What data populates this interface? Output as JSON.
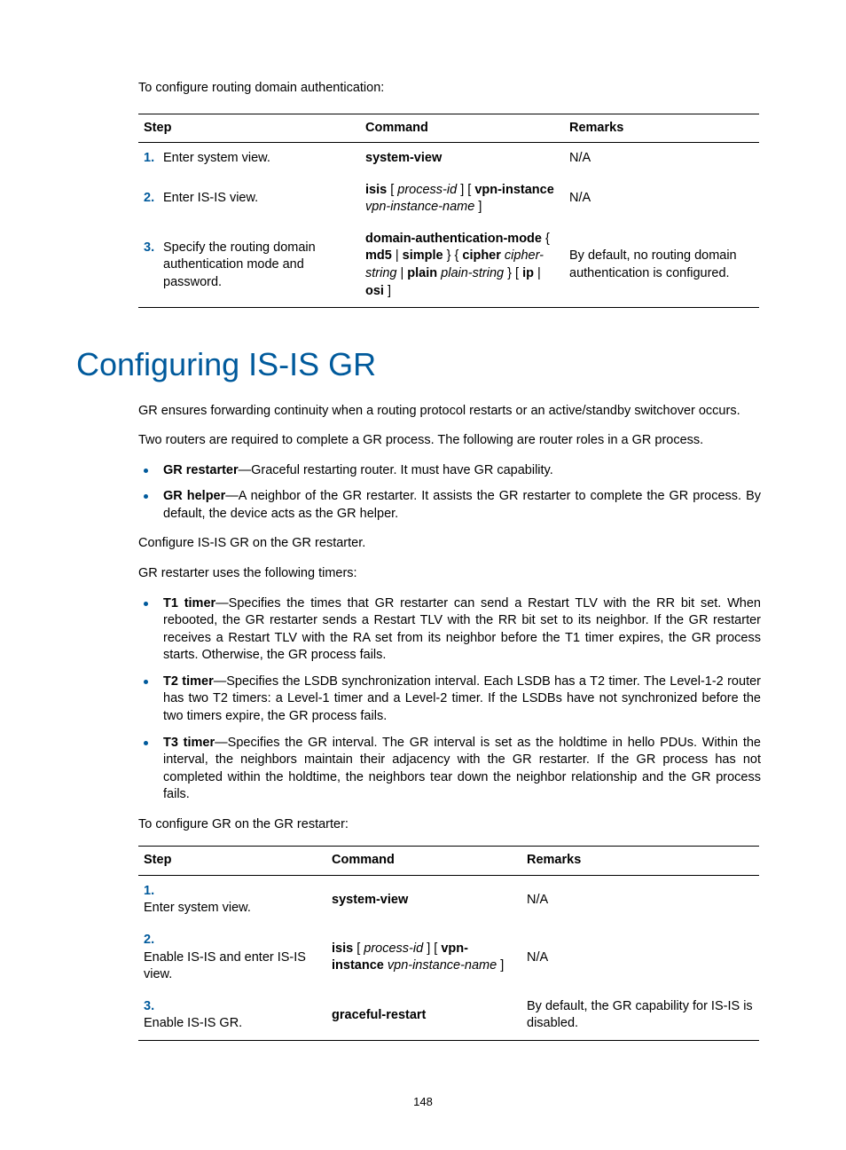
{
  "intro1": "To configure routing domain authentication:",
  "table1": {
    "headers": {
      "step": "Step",
      "command": "Command",
      "remarks": "Remarks"
    },
    "rows": [
      {
        "num": "1.",
        "desc": "Enter system view.",
        "cmd_html": "<b>system-view</b>",
        "remarks": "N/A"
      },
      {
        "num": "2.",
        "desc": "Enter IS-IS view.",
        "cmd_html": "<b>isis</b> [ <i>process-id</i> ] [ <b>vpn-instance</b> <i>vpn-instance-name</i> ]",
        "remarks": "N/A"
      },
      {
        "num": "3.",
        "desc": "Specify the routing domain authentication mode and password.",
        "cmd_html": "<b>domain-authentication-mode</b> { <b>md5</b> | <b>simple</b> } { <b>cipher</b> <i>cipher-string</i> | <b>plain</b> <i>plain-string</i> } [ <b>ip</b> | <b>osi</b> ]",
        "remarks": "By default, no routing domain authentication is configured."
      }
    ]
  },
  "h1": "Configuring IS-IS GR",
  "p1": "GR ensures forwarding continuity when a routing protocol restarts or an active/standby switchover occurs.",
  "p2": "Two routers are required to complete a GR process. The following are router roles in a GR process.",
  "bullets1": [
    {
      "bold": "GR restarter",
      "rest": "—Graceful restarting router. It must have GR capability."
    },
    {
      "bold": "GR helper",
      "rest": "—A neighbor of the GR restarter. It assists the GR restarter to complete the GR process. By default, the device acts as the GR helper."
    }
  ],
  "p3": "Configure IS-IS GR on the GR restarter.",
  "p4": "GR restarter uses the following timers:",
  "bullets2": [
    {
      "bold": "T1 timer",
      "rest": "—Specifies the times that GR restarter can send a Restart TLV with the RR bit set. When rebooted, the GR restarter sends a Restart TLV with the RR bit set to its neighbor. If the GR restarter receives a Restart TLV with the RA set from its neighbor before the T1 timer expires, the GR process starts. Otherwise, the GR process fails."
    },
    {
      "bold": "T2 timer",
      "rest": "—Specifies the LSDB synchronization interval. Each LSDB has a T2 timer. The Level-1-2 router has two T2 timers: a Level-1 timer and a Level-2 timer. If the LSDBs have not synchronized before the two timers expire, the GR process fails."
    },
    {
      "bold": "T3 timer",
      "rest": "—Specifies the GR interval. The GR interval is set as the holdtime in hello PDUs. Within the interval, the neighbors maintain their adjacency with the GR restarter. If the GR process has not completed within the holdtime, the neighbors tear down the neighbor relationship and the GR process fails."
    }
  ],
  "p5": "To configure GR on the GR restarter:",
  "table2": {
    "headers": {
      "step": "Step",
      "command": "Command",
      "remarks": "Remarks"
    },
    "rows": [
      {
        "num": "1.",
        "desc": "Enter system view.",
        "cmd_html": "<b>system-view</b>",
        "remarks": "N/A"
      },
      {
        "num": "2.",
        "desc": "Enable IS-IS and enter IS-IS view.",
        "cmd_html": "<b>isis</b> [ <i>process-id</i> ] [ <b>vpn-instance</b> <i>vpn-instance-name</i> ]",
        "remarks": "N/A"
      },
      {
        "num": "3.",
        "desc": "Enable IS-IS GR.",
        "cmd_html": "<b>graceful-restart</b>",
        "remarks": "By default, the GR capability for IS-IS is disabled."
      }
    ]
  },
  "pagenum": "148"
}
